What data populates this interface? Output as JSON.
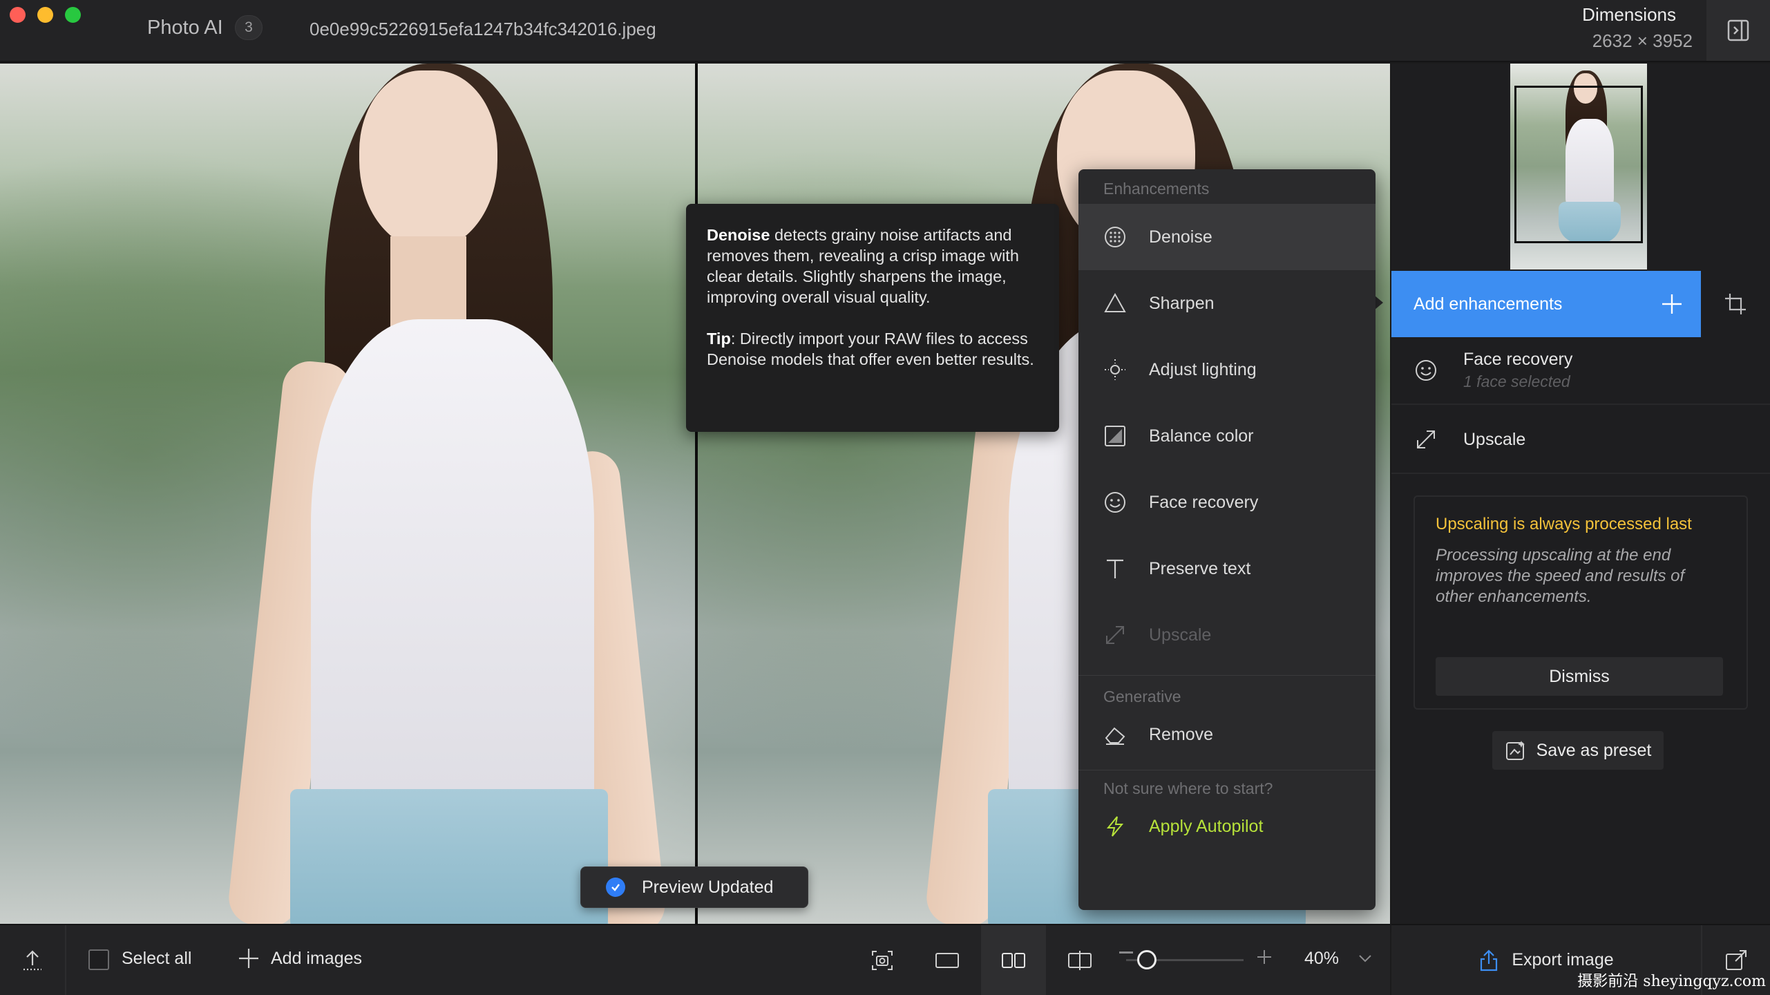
{
  "window": {
    "app_title": "Photo AI",
    "image_count": "3",
    "filename": "0e0e99c5226915efa1247b34fc342016.jpeg",
    "dimensions_label": "Dimensions",
    "dimensions_value": "2632 × 3952"
  },
  "tooltip": {
    "title": "Denoise",
    "body": " detects grainy noise artifacts and removes them, revealing a crisp image with clear details. Slightly sharpens the image, improving overall visual quality.",
    "tip_label": "Tip",
    "tip_body": ": Directly import your RAW files to access Denoise models that offer even better results."
  },
  "menu": {
    "enhancements_header": "Enhancements",
    "items": [
      {
        "label": "Denoise",
        "icon": "denoise-icon",
        "state": "active"
      },
      {
        "label": "Sharpen",
        "icon": "triangle-icon",
        "state": "normal"
      },
      {
        "label": "Adjust lighting",
        "icon": "sun-icon",
        "state": "normal"
      },
      {
        "label": "Balance color",
        "icon": "balance-icon",
        "state": "normal"
      },
      {
        "label": "Face recovery",
        "icon": "smiley-icon",
        "state": "normal"
      },
      {
        "label": "Preserve text",
        "icon": "text-icon",
        "state": "normal"
      },
      {
        "label": "Upscale",
        "icon": "expand-icon",
        "state": "disabled"
      }
    ],
    "generative_header": "Generative",
    "generative_items": [
      {
        "label": "Remove",
        "icon": "eraser-icon"
      }
    ],
    "autopilot_prompt": "Not sure where to start?",
    "autopilot_label": "Apply Autopilot"
  },
  "toast": {
    "label": "Preview Updated"
  },
  "right_panel": {
    "add_enhancements": "Add enhancements",
    "enhancements": [
      {
        "title": "Face recovery",
        "subtitle": "1 face selected"
      },
      {
        "title": "Upscale",
        "subtitle": ""
      }
    ],
    "info_title": "Upscaling is always processed last",
    "info_body": "Processing upscaling at the end improves the speed and results of other enhancements.",
    "dismiss": "Dismiss",
    "save_preset": "Save as preset"
  },
  "bottom_bar": {
    "select_all": "Select all",
    "add_images": "Add images",
    "zoom_value": "40%",
    "export": "Export image"
  },
  "watermark": "摄影前沿 sheyingqyz.com",
  "colors": {
    "accent": "#3d8ef2",
    "autopilot": "#b7e23a",
    "warning": "#f3c13a",
    "toast_check": "#2f7df6"
  }
}
